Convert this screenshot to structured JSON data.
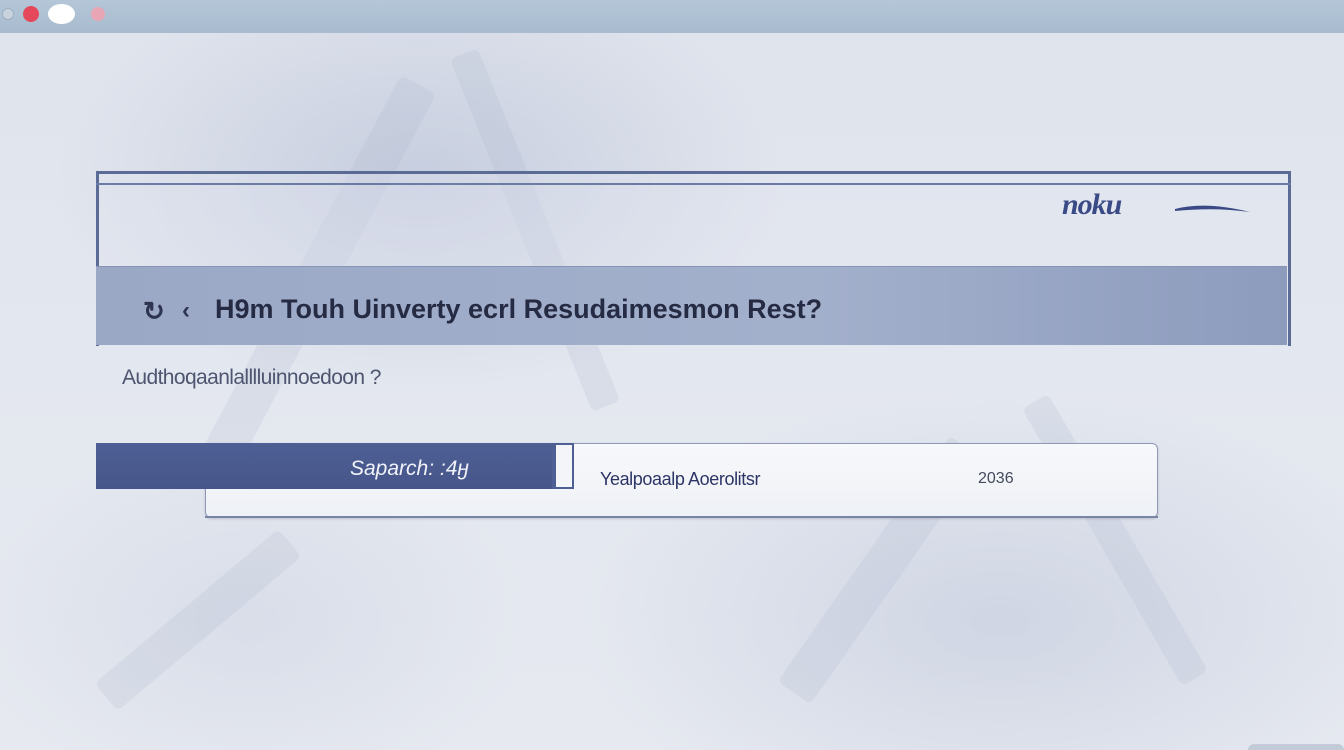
{
  "window": {
    "controls": [
      "minimize",
      "close",
      "expand",
      "zoom"
    ],
    "colors": {
      "close": "#e5485a",
      "expand": "#ffffff",
      "zoom": "#e8a6b4"
    }
  },
  "header": {
    "logo_text": "noku"
  },
  "heading": {
    "icons": [
      "refresh-icon",
      "back-icon"
    ],
    "title": "H9m Touh Uinverty ecrl Resudaimesmon Rest?"
  },
  "subtitle": "Audthoqaanlalllluinnoedoon ?",
  "search": {
    "button_label": "Saparch: :4ӈ",
    "field_label": "Yealpoaalp Aoerolitsr",
    "field_value": "2036"
  },
  "colors": {
    "accent": "#4e5f95",
    "heading_bar": "#9aa8c6",
    "background": "#e3e7ef"
  }
}
